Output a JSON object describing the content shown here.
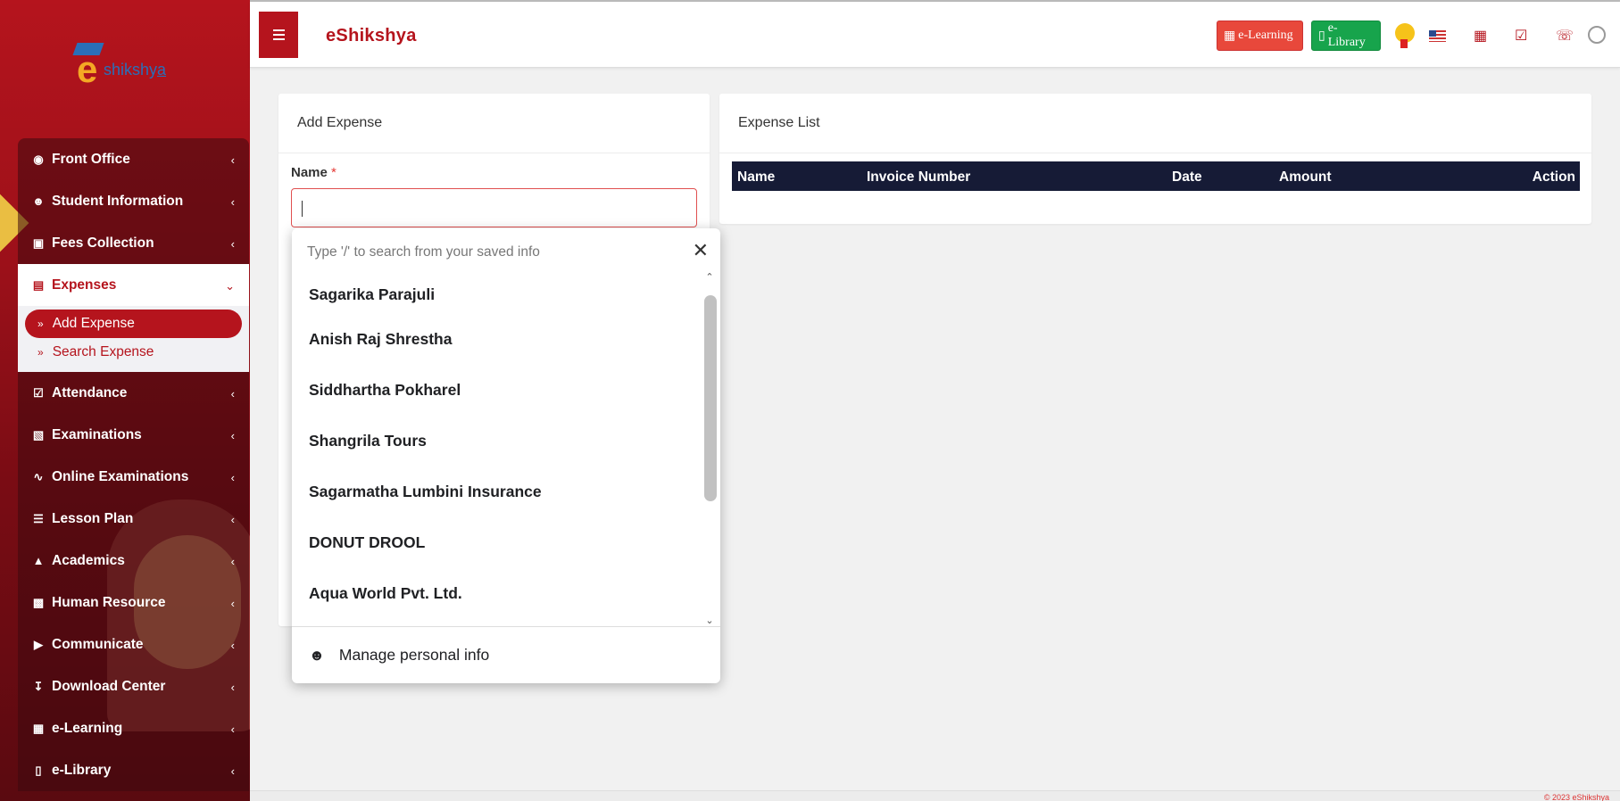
{
  "brand": {
    "logo_text": "eshikshya",
    "app_title": "eShikshya"
  },
  "sidebar": {
    "items": [
      {
        "label": "Front Office",
        "icon": "binoculars-icon"
      },
      {
        "label": "Student Information",
        "icon": "user-plus-icon"
      },
      {
        "label": "Fees Collection",
        "icon": "money-icon"
      },
      {
        "label": "Expenses",
        "icon": "credit-card-icon",
        "expanded": true
      },
      {
        "label": "Attendance",
        "icon": "calendar-check-icon"
      },
      {
        "label": "Examinations",
        "icon": "map-icon"
      },
      {
        "label": "Online Examinations",
        "icon": "rss-icon"
      },
      {
        "label": "Lesson Plan",
        "icon": "list-icon"
      },
      {
        "label": "Academics",
        "icon": "graduation-cap-icon"
      },
      {
        "label": "Human Resource",
        "icon": "sitemap-icon"
      },
      {
        "label": "Communicate",
        "icon": "bullhorn-icon"
      },
      {
        "label": "Download Center",
        "icon": "download-icon"
      },
      {
        "label": "e-Learning",
        "icon": "film-icon"
      },
      {
        "label": "e-Library",
        "icon": "book-icon"
      }
    ],
    "expenses_sub": [
      {
        "label": "Add Expense",
        "active": true
      },
      {
        "label": "Search Expense",
        "active": false
      }
    ]
  },
  "topbar": {
    "elearning_label": "e-Learning",
    "elibrary_label": "e-Library",
    "elearning_color": "#e8483b",
    "elibrary_color": "#17a44c"
  },
  "add_expense": {
    "title": "Add Expense",
    "name_label": "Name",
    "required_mark": "*",
    "name_value": ""
  },
  "expense_list": {
    "title": "Expense List",
    "columns": [
      "Name",
      "Invoice Number",
      "Date",
      "Amount",
      "Action"
    ]
  },
  "autofill": {
    "search_placeholder": "Type '/' to search from your saved info",
    "items": [
      "Sagarika Parajuli",
      "Anish Raj Shrestha",
      "Siddhartha Pokharel",
      "Shangrila Tours",
      "Sagarmatha Lumbini Insurance",
      "DONUT DROOL",
      "Aqua World Pvt. Ltd."
    ],
    "footer_label": "Manage personal info"
  },
  "footer": {
    "copyright": "© 2023 eShikshya"
  },
  "colors": {
    "brand_red": "#b5141d",
    "table_header": "#161b36"
  }
}
